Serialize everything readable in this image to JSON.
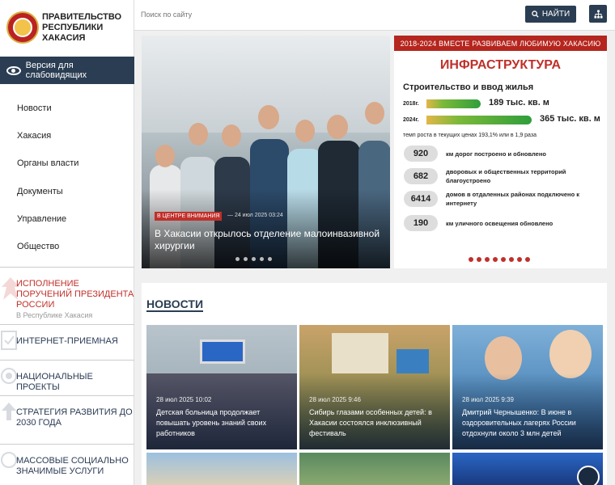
{
  "sidebar": {
    "gov_title": "ПРАВИТЕЛЬСТВО РЕСПУБЛИКИ ХАКАСИЯ",
    "vision_label": "Версия для слабовидящих",
    "nav": [
      "Новости",
      "Хакасия",
      "Органы власти",
      "Документы",
      "Управление",
      "Общество"
    ],
    "blocks": [
      {
        "label": "ИСПОЛНЕНИЕ ПОРУЧЕНИЙ ПРЕЗИДЕНТА РОССИИ",
        "sub": "В Республике Хакасия"
      },
      {
        "label": "ИНТЕРНЕТ-ПРИЕМНАЯ"
      },
      {
        "label": "НАЦИОНАЛЬНЫЕ ПРОЕКТЫ"
      },
      {
        "label": "СТРАТЕГИЯ РАЗВИТИЯ ДО 2030 ГОДА"
      },
      {
        "label": "МАССОВЫЕ СОЦИАЛЬНО ЗНАЧИМЫЕ УСЛУГИ"
      }
    ]
  },
  "header": {
    "search_placeholder": "Поиск по сайту",
    "search_button": "НАЙТИ"
  },
  "hero": {
    "badge": "В ЦЕНТРЕ ВНИМАНИЯ",
    "date": "— 24 июл 2025 03:24",
    "title": "В Хакасии открылось отделение малоинвазивной хирургии",
    "slide_count": 5
  },
  "infographic": {
    "banner": "2018-2024 ВМЕСТЕ РАЗВИВАЕМ ЛЮБИМУЮ ХАКАСИЮ",
    "title": "ИНФРАСТРУКТУРА",
    "subtitle": "Строительство и ввод жилья",
    "rows": [
      {
        "year": "2018г.",
        "value": "189 тыс. кв. м",
        "amount": 189
      },
      {
        "year": "2024г.",
        "value": "365 тыс. кв. м",
        "amount": 365
      }
    ],
    "growth": "темп роста в текущих ценах 193,1% или в 1,9 раза",
    "stats": [
      {
        "num": "920",
        "text": "км дорог построено и обновлено"
      },
      {
        "num": "682",
        "text": "дворовых и общественных территорий благоустроено"
      },
      {
        "num": "6414",
        "text": "домов в отдаленных районах подключено к интернету"
      },
      {
        "num": "190",
        "text": "км уличного освещения обновлено"
      }
    ],
    "slide_count": 8
  },
  "news": {
    "heading": "НОВОСТИ",
    "items": [
      {
        "date": "28 июл 2025 10:02",
        "title": "Детская больница продолжает повышать уровень знаний своих работников"
      },
      {
        "date": "28 июл 2025 9:46",
        "title": "Сибирь глазами особенных детей: в Хакасии состоялся инклюзивный фестиваль"
      },
      {
        "date": "28 июл 2025 9:39",
        "title": "Дмитрий Чернышенко: В июне в оздоровительных лагерях России отдохнули около 3 млн детей"
      }
    ]
  },
  "colors": {
    "accent": "#2a3d52",
    "brand_red": "#c0302a"
  }
}
